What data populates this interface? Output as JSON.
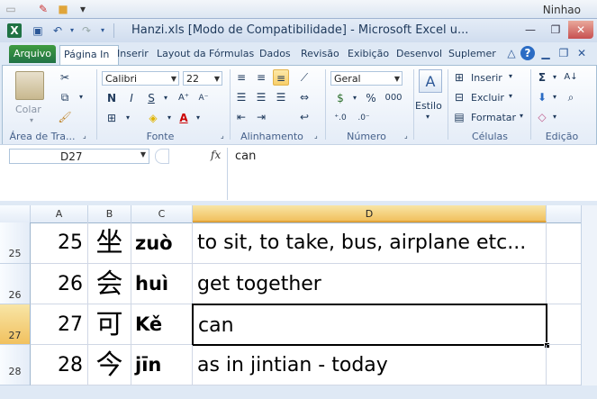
{
  "desktop": {
    "label": "Ninhao"
  },
  "window": {
    "title": "Hanzi.xls  [Modo de Compatibilidade]  -  Microsoft Excel u...",
    "app_icon": "X"
  },
  "tabs": [
    {
      "label": "Arquivo"
    },
    {
      "label": "Página In"
    },
    {
      "label": "Inserir"
    },
    {
      "label": "Layout da"
    },
    {
      "label": "Fórmulas"
    },
    {
      "label": "Dados"
    },
    {
      "label": "Revisão"
    },
    {
      "label": "Exibição"
    },
    {
      "label": "Desenvol"
    },
    {
      "label": "Suplemer"
    }
  ],
  "ribbon": {
    "clipboard": {
      "label": "Área de Tra...",
      "paste": "Colar"
    },
    "font": {
      "label": "Fonte",
      "name": "Calibri",
      "size": "22",
      "bold": "N",
      "italic": "I",
      "underline": "S"
    },
    "alignment": {
      "label": "Alinhamento"
    },
    "number": {
      "label": "Número",
      "format": "Geral",
      "thousands": "000"
    },
    "styles": {
      "button": "Estilo"
    },
    "cells": {
      "label": "Células",
      "insert": "Inserir",
      "delete": "Excluir",
      "format": "Formatar"
    },
    "editing": {
      "label": "Edição"
    }
  },
  "formula_bar": {
    "name_box": "D27",
    "fx": "fx",
    "value": "can"
  },
  "grid": {
    "columns": [
      "A",
      "B",
      "C",
      "D"
    ],
    "selected_column": "D",
    "selected_row": "27",
    "rows": [
      {
        "row": "25",
        "a": "25",
        "b": "坐",
        "c": "zuò",
        "d": "to sit, to take, bus, airplane etc..."
      },
      {
        "row": "26",
        "a": "26",
        "b": "会",
        "c": "huì",
        "d": "get together"
      },
      {
        "row": "27",
        "a": "27",
        "b": "可",
        "c": "Kě",
        "d": "can"
      },
      {
        "row": "28",
        "a": "28",
        "b": "今",
        "c": "jīn",
        "d": "as in jintian - today"
      }
    ]
  }
}
